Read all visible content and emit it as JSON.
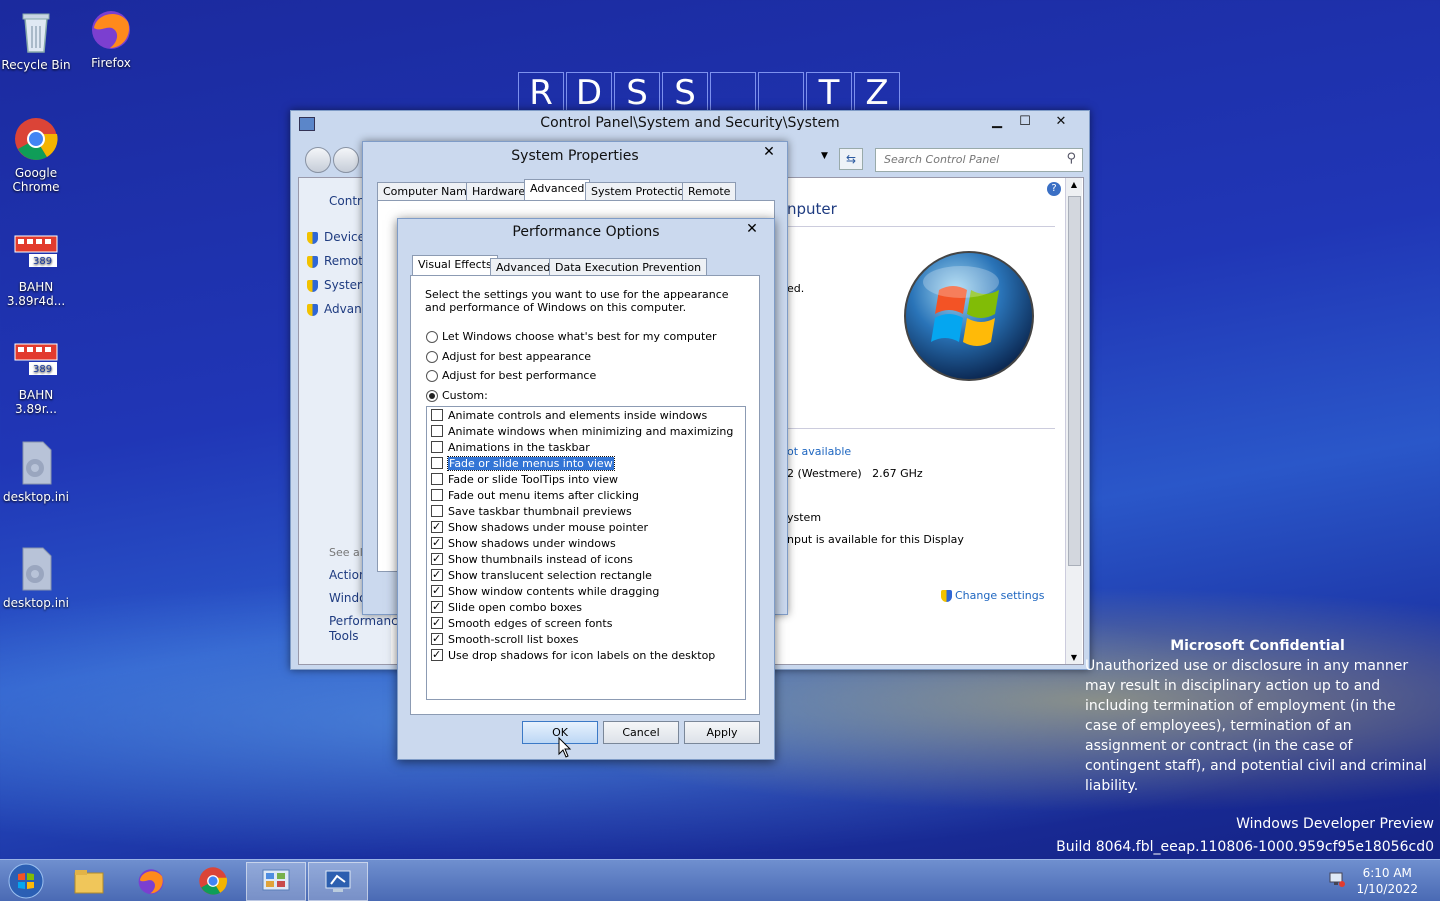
{
  "desktop": {
    "icons": [
      {
        "label": "Recycle Bin"
      },
      {
        "label": "Firefox"
      },
      {
        "label": "Google Chrome"
      },
      {
        "label": "BAHN 3.89r4d..."
      },
      {
        "label": "BAHN 3.89r..."
      },
      {
        "label": "desktop.ini"
      },
      {
        "label": "desktop.ini"
      }
    ],
    "banner": [
      "R",
      "D",
      "S",
      "S",
      "",
      "",
      "T",
      "Z"
    ],
    "confidential_title": "Microsoft Confidential",
    "confidential_text": "Unauthorized use or disclosure in any manner may result in disciplinary action up to and including termination of employment (in the case of employees), termination of an assignment or contract (in the case of contingent staff), and potential civil and criminal liability.",
    "watermark_line1": "Windows Developer Preview",
    "watermark_line2": "Build 8064.fbl_eeap.110806-1000.959cf95e18056cd0"
  },
  "control_panel": {
    "title": "Control Panel\\System and Security\\System",
    "search_placeholder": "Search Control Panel",
    "left_links": {
      "home": "Contro",
      "device": "Device",
      "remote": "Remot",
      "system": "System",
      "advanced": "Advan",
      "see_also": "See als",
      "action": "Action",
      "windows": "Windo",
      "performance": "Performance",
      "tools": "Tools"
    },
    "content": {
      "heading_fragment": "nputer",
      "line1": "ed.",
      "not_available": "ot available",
      "processor": "2 (Westmere)   2.67 GHz",
      "system_type": "ystem",
      "pen": "nput is available for this Display",
      "change_settings": "Change settings"
    }
  },
  "system_properties": {
    "title": "System Properties",
    "tabs": [
      "Computer Name",
      "Hardware",
      "Advanced",
      "System Protection",
      "Remote"
    ]
  },
  "performance_options": {
    "title": "Performance Options",
    "tabs": [
      "Visual Effects",
      "Advanced",
      "Data Execution Prevention"
    ],
    "description": "Select the settings you want to use for the appearance and performance of Windows on this computer.",
    "radios": [
      {
        "label": "Let Windows choose what's best for my computer",
        "selected": false
      },
      {
        "label": "Adjust for best appearance",
        "selected": false
      },
      {
        "label": "Adjust for best performance",
        "selected": false
      },
      {
        "label": "Custom:",
        "selected": true
      }
    ],
    "effects": [
      {
        "label": "Animate controls and elements inside windows",
        "checked": false
      },
      {
        "label": "Animate windows when minimizing and maximizing",
        "checked": false
      },
      {
        "label": "Animations in the taskbar",
        "checked": false
      },
      {
        "label": "Fade or slide menus into view",
        "checked": false
      },
      {
        "label": "Fade or slide ToolTips into view",
        "checked": false
      },
      {
        "label": "Fade out menu items after clicking",
        "checked": false
      },
      {
        "label": "Save taskbar thumbnail previews",
        "checked": false
      },
      {
        "label": "Show shadows under mouse pointer",
        "checked": true
      },
      {
        "label": "Show shadows under windows",
        "checked": true
      },
      {
        "label": "Show thumbnails instead of icons",
        "checked": true
      },
      {
        "label": "Show translucent selection rectangle",
        "checked": true
      },
      {
        "label": "Show window contents while dragging",
        "checked": true
      },
      {
        "label": "Slide open combo boxes",
        "checked": true
      },
      {
        "label": "Smooth edges of screen fonts",
        "checked": true
      },
      {
        "label": "Smooth-scroll list boxes",
        "checked": true
      },
      {
        "label": "Use drop shadows for icon labels on the desktop",
        "checked": true
      }
    ],
    "ok_label": "OK",
    "cancel_label": "Cancel",
    "apply_label": "Apply"
  },
  "taskbar": {
    "time": "6:10 AM",
    "date": "1/10/2022"
  }
}
